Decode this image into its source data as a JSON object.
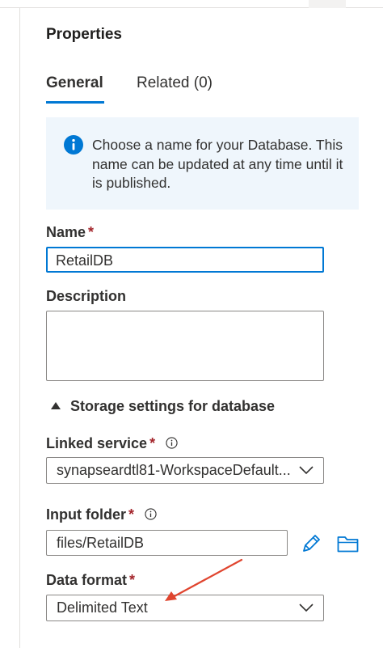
{
  "panel": {
    "title": "Properties"
  },
  "tabs": [
    {
      "label": "General",
      "active": true
    },
    {
      "label": "Related (0)",
      "active": false
    }
  ],
  "info": {
    "text": "Choose a name for your Database. This name can be updated at any time until it is published.",
    "icon": "info-icon"
  },
  "name": {
    "label": "Name",
    "required_mark": "*",
    "value": "RetailDB"
  },
  "description": {
    "label": "Description",
    "value": ""
  },
  "storage": {
    "section_label": "Storage settings for database"
  },
  "linked_service": {
    "label": "Linked service",
    "required_mark": "*",
    "value": "synapseardtl81-WorkspaceDefault..."
  },
  "input_folder": {
    "label": "Input folder",
    "required_mark": "*",
    "value": "files/RetailDB"
  },
  "data_format": {
    "label": "Data format",
    "required_mark": "*",
    "value": "Delimited Text"
  },
  "colors": {
    "accent": "#0078d4",
    "required": "#a4262c",
    "info_bg": "#eff6fc",
    "annotation_arrow": "#e0452f"
  }
}
